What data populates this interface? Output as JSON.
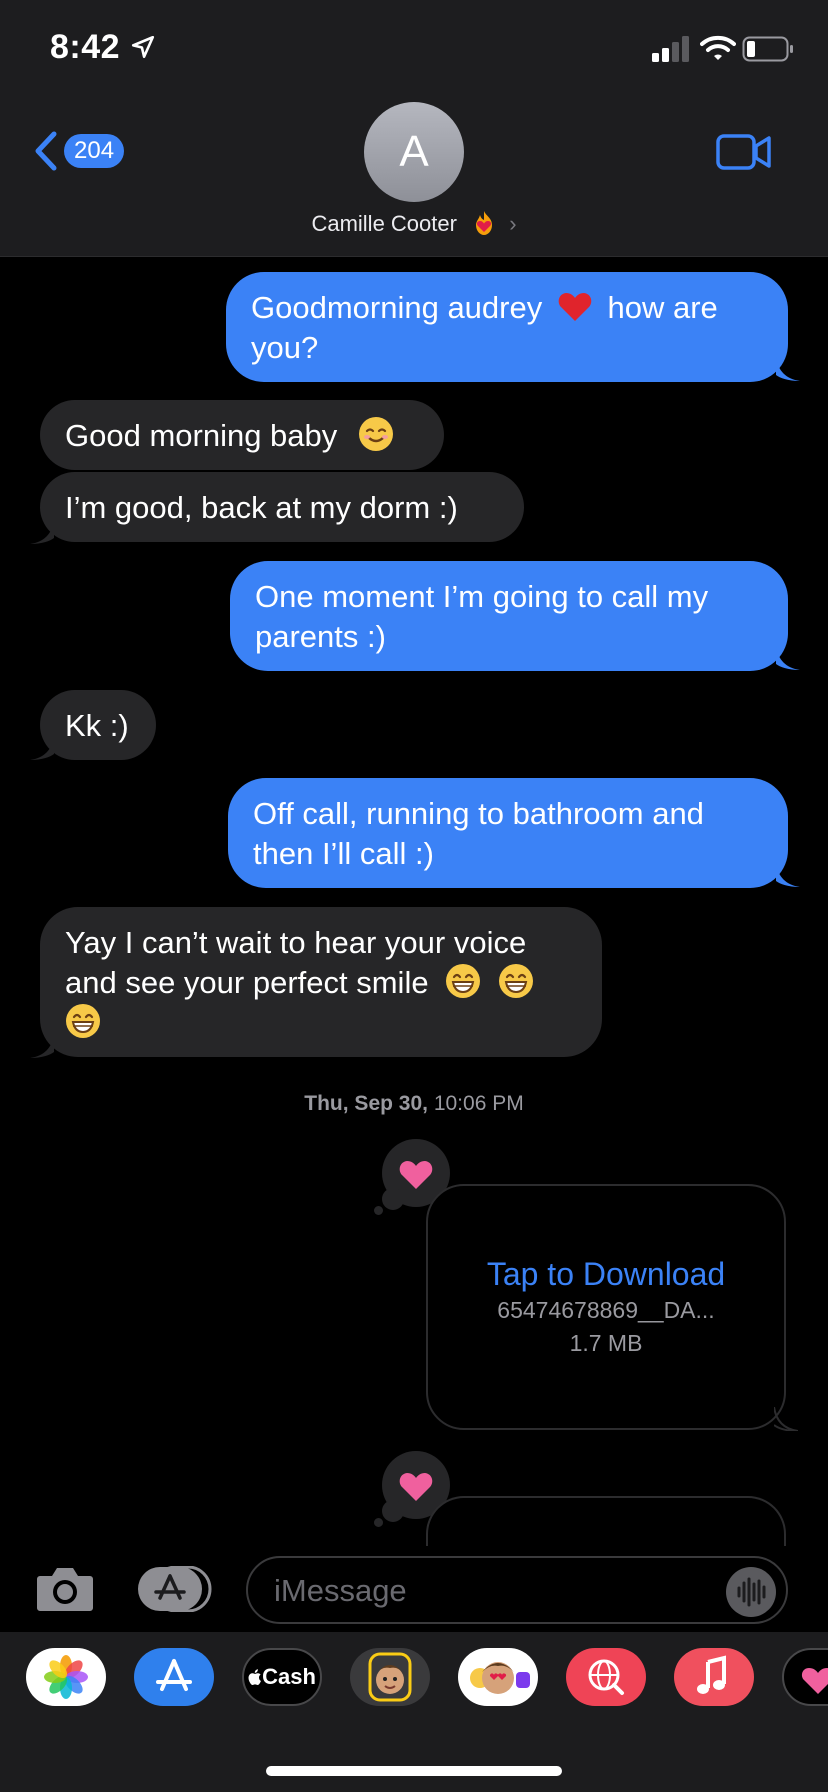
{
  "status_bar": {
    "time": "8:42"
  },
  "header": {
    "back_count": "204",
    "avatar_initial": "A",
    "contact_name": "Camille Cooter",
    "contact_chevron": "›"
  },
  "messages": [
    {
      "dir": "sent",
      "text_a": "Goodmorning audrey",
      "emoji": "red-heart",
      "text_b": "how are you?"
    },
    {
      "dir": "recv",
      "text": "Good morning baby",
      "emoji": "smiling-face"
    },
    {
      "dir": "recv",
      "text": "I’m good, back at my dorm :)"
    },
    {
      "dir": "sent",
      "text": "One moment I’m going to call my parents :)"
    },
    {
      "dir": "recv",
      "text": "Kk :)"
    },
    {
      "dir": "sent",
      "text": "Off call, running to bathroom and then I’ll call :)"
    },
    {
      "dir": "recv",
      "text": "Yay I can’t wait to hear your voice and see your perfect smile",
      "emoji": "grinning-face"
    }
  ],
  "timestamp": {
    "day": "Thu, Sep 30,",
    "time": "10:06 PM"
  },
  "attachment": {
    "action": "Tap to Download",
    "filename": "65474678869__DA...",
    "size": "1.7 MB",
    "tapback": "heart"
  },
  "composer": {
    "placeholder": "iMessage"
  },
  "apps": [
    {
      "name": "Photos"
    },
    {
      "name": "App Store"
    },
    {
      "name": "Cash",
      "label": "Cash"
    },
    {
      "name": "Memoji Stickers"
    },
    {
      "name": "Animoji"
    },
    {
      "name": "Web Images"
    },
    {
      "name": "Music"
    },
    {
      "name": "Digital Touch"
    }
  ],
  "colors": {
    "sent_bubble": "#3b82f6",
    "received_bubble": "#262628",
    "background": "#000000",
    "header": "#1d1d1f",
    "accent": "#3b82f6"
  }
}
